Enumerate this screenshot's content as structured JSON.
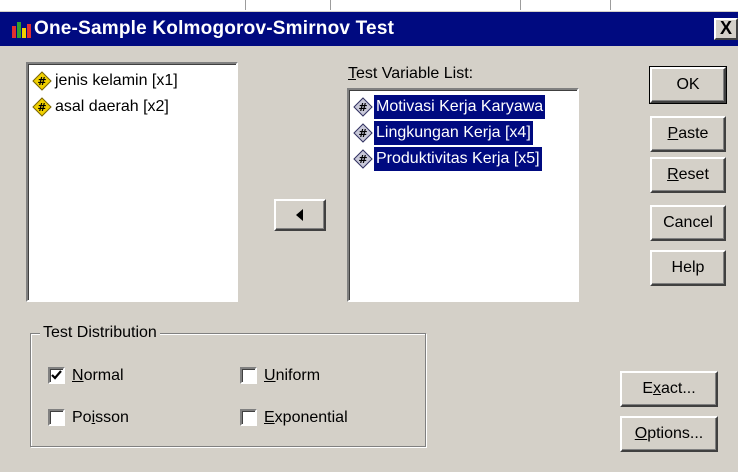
{
  "window": {
    "title": "One-Sample Kolmogorov-Smirnov Test",
    "close_glyph": "X",
    "icon": "spss-app-icon"
  },
  "source_list": {
    "items": [
      {
        "label": "jenis kelamin [x1]",
        "icon": "numeric-variable-icon"
      },
      {
        "label": "asal daerah [x2]",
        "icon": "numeric-variable-icon"
      }
    ]
  },
  "move_button": {
    "icon": "arrow-left-icon"
  },
  "test_variable_list": {
    "label_key": "T",
    "label_rest": "est Variable List:",
    "items": [
      {
        "label": "Motivasi Kerja Karyawa",
        "icon": "numeric-variable-icon",
        "selected": true
      },
      {
        "label": "Lingkungan Kerja [x4]",
        "icon": "numeric-variable-icon",
        "selected": true
      },
      {
        "label": "Produktivitas Kerja [x5]",
        "icon": "numeric-variable-icon",
        "selected": true
      }
    ]
  },
  "buttons": {
    "ok": "OK",
    "paste": {
      "key": "P",
      "rest": "aste"
    },
    "reset": {
      "key": "R",
      "rest": "eset"
    },
    "cancel": "Cancel",
    "help": "Help",
    "exact": {
      "before": "E",
      "key": "x",
      "rest": "act..."
    },
    "options": {
      "key": "O",
      "rest": "ptions..."
    }
  },
  "test_distribution": {
    "title": "Test Distribution",
    "normal": {
      "key": "N",
      "rest": "ormal",
      "checked": true
    },
    "uniform": {
      "key": "U",
      "rest": "niform",
      "checked": false
    },
    "poisson": {
      "before": "Po",
      "key": "i",
      "rest": "sson",
      "checked": false
    },
    "exponential": {
      "key": "E",
      "rest": "xponential",
      "checked": false
    }
  },
  "colors": {
    "dialog_bg": "#d4d0c8",
    "titlebar": "#000a80",
    "selection": "#000a80",
    "variable_icon_fill": "#f0d000"
  }
}
